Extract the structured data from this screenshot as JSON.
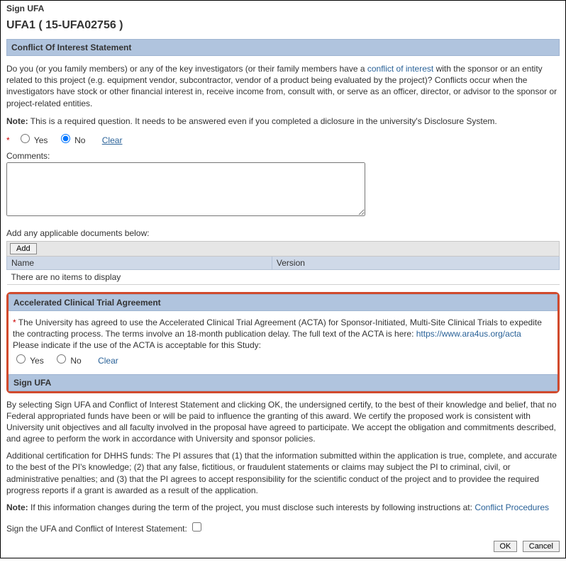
{
  "page_title": "Sign UFA",
  "ufa_id": "UFA1 ( 15-UFA02756 )",
  "coi": {
    "header": "Conflict Of Interest Statement",
    "para_pre": "Do you (or you family members) or any of the key investigators (or their family members have a ",
    "coi_link": "conflict of interest",
    "para_post": " with the sponsor or an entity related to this project (e.g. equipment vendor, subcontractor, vendor of a product being evaluated by the project)? Conflicts occur when the investigators have stock or other financial interest in, receive income from, consult with, or serve as an officer, director, or advisor to the sponsor or project-related entities.",
    "note_label": "Note:",
    "note_text": " This is a required question. It needs to be answered even if you completed a diclosure in the university's Disclosure System.",
    "yes_label": "Yes",
    "no_label": "No",
    "clear_label": "Clear",
    "no_selected": true,
    "comments_label": "Comments:"
  },
  "docs": {
    "add_label": "Add any applicable documents below:",
    "add_button": "Add",
    "col_name": "Name",
    "col_version": "Version",
    "empty_text": "There are no items to display"
  },
  "acta": {
    "header": "Accelerated Clinical Trial Agreement",
    "asterisk": "*",
    "text": " The University has agreed to use the Accelerated Clinical Trial Agreement (ACTA) for Sponsor-Initiated, Multi-Site Clinical Trials to expedite the contracting process. The terms involve an 18-month publication delay. The full text of the ACTA is here: ",
    "link": "https://www.ara4us.org/acta",
    "question": "Please indicate if the use of the ACTA is acceptable for this Study:",
    "yes_label": "Yes",
    "no_label": "No",
    "clear_label": "Clear"
  },
  "sign": {
    "header": "Sign UFA",
    "cert1": "By selecting Sign UFA and Conflict of Interest Statement and clicking OK, the undersigned certify, to the best of their knowledge and belief, that no Federal appropriated funds have been or will be paid to influence the granting of this award. We certify the proposed work is consistent with University unit objectives and all faculty involved in the proposal have agreed to participate.  We accept the obligation and commitments described, and agree to perform the work in accordance with University and sponsor policies.",
    "cert2": "Additional certification for DHHS funds: The PI assures that (1) that the information submitted within the application is true, complete, and accurate to the best of the PI's knowledge; (2) that any false, fictitious, or fraudulent statements or claims may subject the PI to criminal, civil, or administrative penalties; and (3) that the PI agrees to accept responsibility for the scientific conduct of the project and to providee the required progress reports if a grant is awarded as a result of the application.",
    "note_label": "Note:",
    "note_text": " If this information changes during the term of the project, you must disclose such interests by following instructions at: ",
    "note_link": "Conflict Procedures",
    "sign_label": "Sign the UFA and Conflict of Interest Statement: "
  },
  "buttons": {
    "ok": "OK",
    "cancel": "Cancel"
  }
}
